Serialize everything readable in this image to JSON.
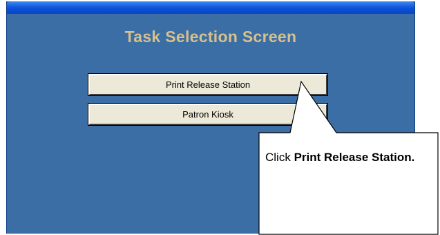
{
  "window": {
    "heading": "Task Selection Screen"
  },
  "tasks": [
    {
      "label": "Print Release Station"
    },
    {
      "label": "Patron Kiosk"
    }
  ],
  "callout": {
    "prefix": "Click ",
    "emphasis": "Print Release Station."
  },
  "colors": {
    "window_background": "#3a6ea5",
    "heading_color": "#d8c08c",
    "button_face": "#ece9d8",
    "titlebar_blue": "#0a4ed8"
  }
}
